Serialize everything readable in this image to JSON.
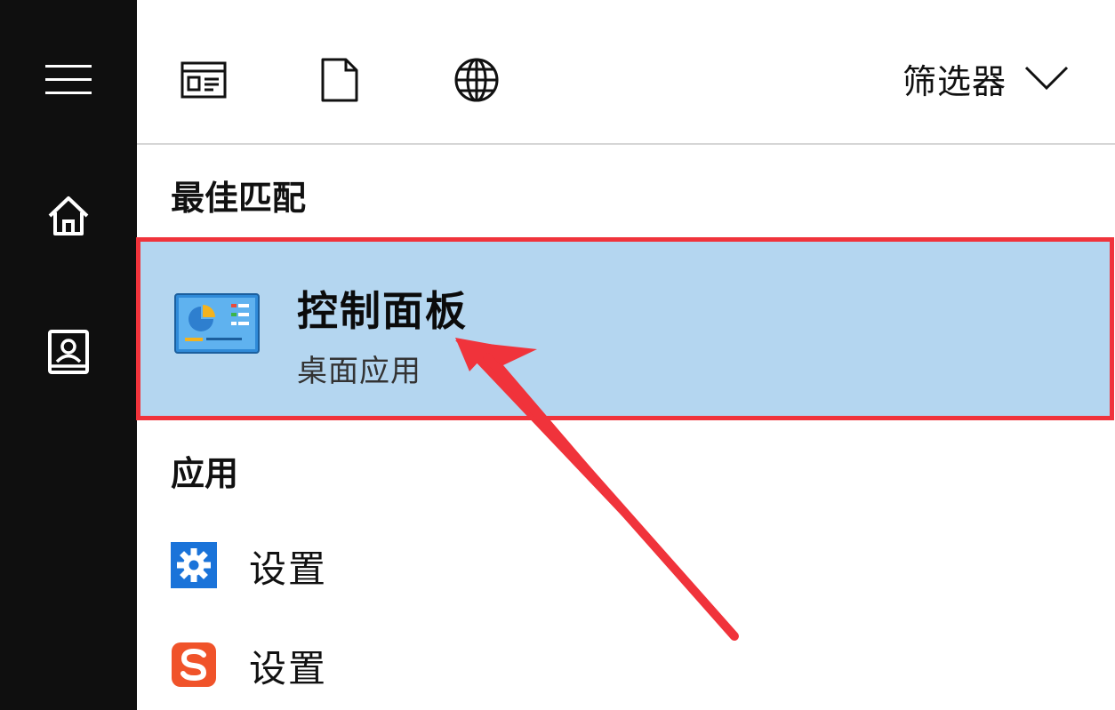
{
  "toolbar": {
    "icons": [
      "apps-icon",
      "document-icon",
      "web-icon"
    ],
    "filter_label": "筛选器"
  },
  "sidebar": {
    "items": [
      "menu-icon",
      "home-icon",
      "notebook-icon"
    ]
  },
  "sections": {
    "best_match": {
      "heading": "最佳匹配",
      "item": {
        "title": "控制面板",
        "subtitle": "桌面应用",
        "icon": "control-panel-icon"
      }
    },
    "apps": {
      "heading": "应用",
      "items": [
        {
          "label": "设置",
          "icon": "settings-gear-icon",
          "color": "#1a73d9"
        },
        {
          "label": "设置",
          "icon": "sogou-s-icon",
          "color": "#f0532a"
        }
      ]
    }
  },
  "colors": {
    "rail_bg": "#0f0f0f",
    "highlight_bg": "#b4d6f0",
    "annotation_red": "#f0333b"
  }
}
